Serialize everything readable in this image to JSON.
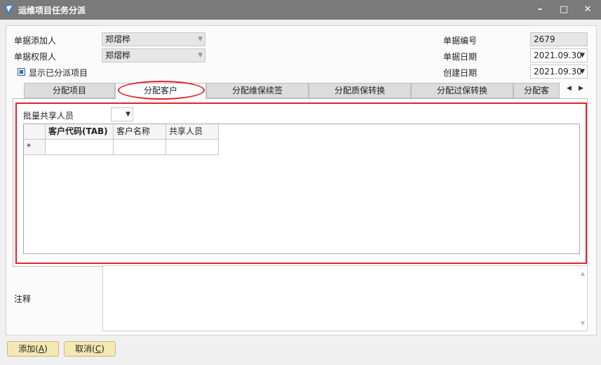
{
  "window": {
    "title": "运维项目任务分派",
    "controls": [
      "minimize-icon",
      "maximize-icon",
      "close-icon"
    ]
  },
  "form": {
    "creator_label": "单据添加人",
    "creator_value": "郑熠桦",
    "owner_label": "单据权限人",
    "owner_value": "郑熠桦",
    "show_assigned_label": "显示已分派项目",
    "doc_no_label": "单据编号",
    "doc_no_value": "2679",
    "doc_date_label": "单据日期",
    "doc_date_value": "2021.09.30",
    "created_date_label": "创建日期",
    "created_date_value": "2021.09.30"
  },
  "tabs": [
    {
      "label": "分配项目",
      "active": false
    },
    {
      "label": "分配客户",
      "active": true
    },
    {
      "label": "分配维保续签",
      "active": false
    },
    {
      "label": "分配质保转换",
      "active": false
    },
    {
      "label": "分配过保转换",
      "active": false
    },
    {
      "label": "分配客",
      "active": false
    }
  ],
  "panel": {
    "batch_share_label": "批量共享人员",
    "grid_columns": [
      "客户代码(TAB)",
      "客户名称",
      "共享人员"
    ],
    "new_row_marker": "*"
  },
  "notes_label": "注释",
  "buttons": {
    "add": "添加",
    "add_key": "A",
    "cancel": "取消",
    "cancel_key": "C"
  },
  "colors": {
    "titlebar": "#7a7a7a",
    "highlight": "#e0242a",
    "button_bg": "#f4e9b3"
  }
}
